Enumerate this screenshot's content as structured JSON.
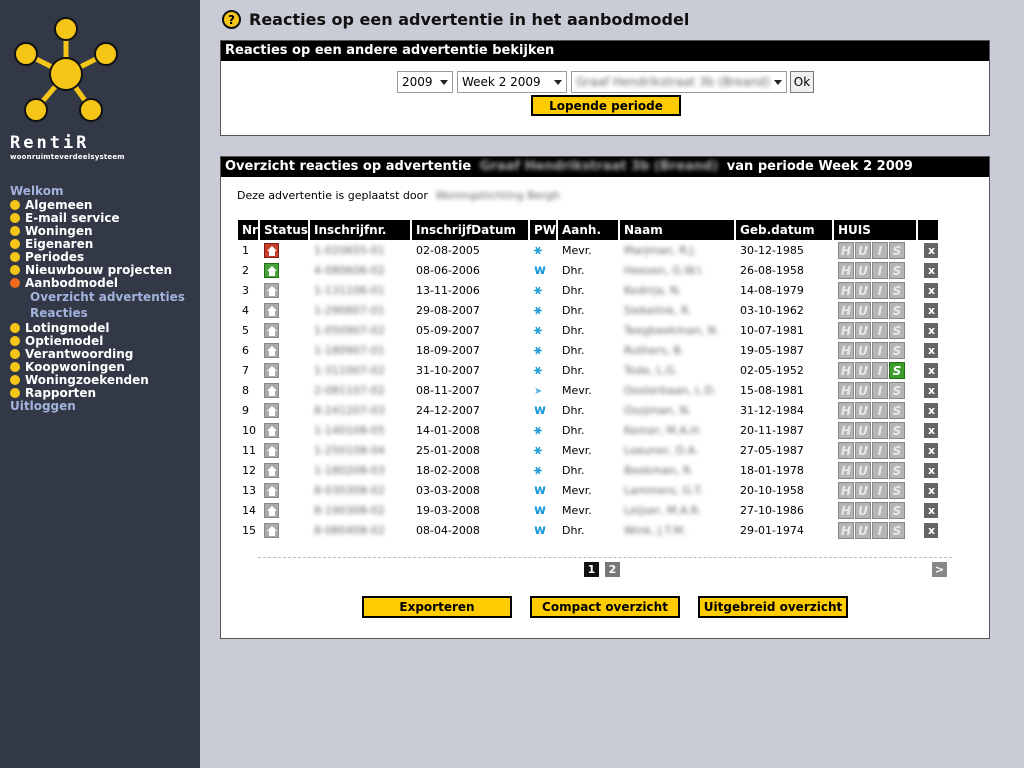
{
  "app": {
    "logo_text": "RentiR",
    "logo_subtitle": "woonruimteverdeelsysteem"
  },
  "sidebar": {
    "welcome": "Welkom",
    "items": [
      {
        "label": "Algemeen"
      },
      {
        "label": "E-mail service"
      },
      {
        "label": "Woningen"
      },
      {
        "label": "Eigenaren"
      },
      {
        "label": "Periodes"
      },
      {
        "label": "Nieuwbouw projecten"
      },
      {
        "label": "Aanbodmodel",
        "active": true
      }
    ],
    "subitems": [
      {
        "label": "Overzicht advertenties"
      },
      {
        "label": "Reacties"
      }
    ],
    "items2": [
      {
        "label": "Lotingmodel"
      },
      {
        "label": "Optiemodel"
      },
      {
        "label": "Verantwoording"
      },
      {
        "label": "Koopwoningen"
      },
      {
        "label": "Woningzoekenden"
      },
      {
        "label": "Rapporten"
      }
    ],
    "logout": "Uitloggen"
  },
  "header": {
    "help_icon": "?",
    "title": "Reacties op een advertentie in het aanbodmodel"
  },
  "selector_panel": {
    "title": "Reacties op een andere advertentie bekijken",
    "year_value": "2009",
    "week_value": "Week 2 2009",
    "address_value": "Graaf Hendrikstraat 3b (Breand)",
    "ok_label": "Ok",
    "current_period_label": "Lopende periode"
  },
  "overview_panel": {
    "title_prefix": "Overzicht reacties op advertentie",
    "title_address": "Graaf Hendrikstraat 3b (Breand)",
    "title_suffix": "van periode Week 2 2009",
    "placed_by_label": "Deze advertentie is geplaatst door",
    "placed_by_value": "Woningstichting Bergh",
    "columns": [
      "Nr",
      "Status",
      "Inschrijfnr.",
      "InschrijfDatum",
      "PW",
      "Aanh.",
      "Naam",
      "Geb.datum",
      "HUIS",
      ""
    ],
    "rows": [
      {
        "nr": "1",
        "status": "red",
        "inschrijfnr": "1-020655-01",
        "datum": "02-08-2005",
        "pw": "tree",
        "aanh": "Mevr.",
        "naam": "Marjman, R.J.",
        "geb": "30-12-1985",
        "huis_s": false
      },
      {
        "nr": "2",
        "status": "green",
        "inschrijfnr": "4-080606-02",
        "datum": "08-06-2006",
        "pw": "w",
        "aanh": "Dhr.",
        "naam": "Heesen, G.W.I.",
        "geb": "26-08-1958",
        "huis_s": false
      },
      {
        "nr": "3",
        "status": "grey",
        "inschrijfnr": "1-131106-01",
        "datum": "13-11-2006",
        "pw": "tree",
        "aanh": "Dhr.",
        "naam": "Kedrrja, N.",
        "geb": "14-08-1979",
        "huis_s": false
      },
      {
        "nr": "4",
        "status": "grey",
        "inschrijfnr": "1-290807-01",
        "datum": "29-08-2007",
        "pw": "tree",
        "aanh": "Dhr.",
        "naam": "Siebelink, R.",
        "geb": "03-10-1962",
        "huis_s": false
      },
      {
        "nr": "5",
        "status": "grey",
        "inschrijfnr": "1-050907-02",
        "datum": "05-09-2007",
        "pw": "tree",
        "aanh": "Dhr.",
        "naam": "Teegbeekman, N.",
        "geb": "10-07-1981",
        "huis_s": false
      },
      {
        "nr": "6",
        "status": "grey",
        "inschrijfnr": "1-180907-01",
        "datum": "18-09-2007",
        "pw": "tree",
        "aanh": "Dhr.",
        "naam": "Ruthers, B.",
        "geb": "19-05-1987",
        "huis_s": false
      },
      {
        "nr": "7",
        "status": "grey",
        "inschrijfnr": "1-311007-02",
        "datum": "31-10-2007",
        "pw": "tree",
        "aanh": "Dhr.",
        "naam": "Tode, L.G.",
        "geb": "02-05-1952",
        "huis_s": true
      },
      {
        "nr": "8",
        "status": "grey",
        "inschrijfnr": "2-081107-02",
        "datum": "08-11-2007",
        "pw": "arrow",
        "aanh": "Mevr.",
        "naam": "Oosterbaan, L.D.",
        "geb": "15-08-1981",
        "huis_s": false
      },
      {
        "nr": "9",
        "status": "grey",
        "inschrijfnr": "8-241207-03",
        "datum": "24-12-2007",
        "pw": "w",
        "aanh": "Dhr.",
        "naam": "Oozjman, N.",
        "geb": "31-12-1984",
        "huis_s": false
      },
      {
        "nr": "10",
        "status": "grey",
        "inschrijfnr": "1-140108-05",
        "datum": "14-01-2008",
        "pw": "tree",
        "aanh": "Dhr.",
        "naam": "Kemer, M.A.H.",
        "geb": "20-11-1987",
        "huis_s": false
      },
      {
        "nr": "11",
        "status": "grey",
        "inschrijfnr": "1-250108-04",
        "datum": "25-01-2008",
        "pw": "tree",
        "aanh": "Mevr.",
        "naam": "Loeuner, D.A.",
        "geb": "27-05-1987",
        "huis_s": false
      },
      {
        "nr": "12",
        "status": "grey",
        "inschrijfnr": "1-180208-03",
        "datum": "18-02-2008",
        "pw": "tree",
        "aanh": "Dhr.",
        "naam": "Beekman, R.",
        "geb": "18-01-1978",
        "huis_s": false
      },
      {
        "nr": "13",
        "status": "grey",
        "inschrijfnr": "8-030308-02",
        "datum": "03-03-2008",
        "pw": "w",
        "aanh": "Mevr.",
        "naam": "Lammers, G.T.",
        "geb": "20-10-1958",
        "huis_s": false
      },
      {
        "nr": "14",
        "status": "grey",
        "inschrijfnr": "8-190308-02",
        "datum": "19-03-2008",
        "pw": "w",
        "aanh": "Mevr.",
        "naam": "Leijser, M.A.R.",
        "geb": "27-10-1986",
        "huis_s": false
      },
      {
        "nr": "15",
        "status": "grey",
        "inschrijfnr": "8-080408-02",
        "datum": "08-04-2008",
        "pw": "w",
        "aanh": "Dhr.",
        "naam": "Wink, J.T.M.",
        "geb": "29-01-1974",
        "huis_s": false
      }
    ],
    "huis_letters": [
      "H",
      "U",
      "I",
      "S"
    ],
    "remove_label": "x",
    "pages": [
      "1",
      "2"
    ],
    "current_page": "1",
    "next_label": ">",
    "buttons": {
      "export": "Exporteren",
      "compact": "Compact overzicht",
      "extended": "Uitgebreid overzicht"
    }
  },
  "colors": {
    "background": "#c9ccd6",
    "sidebar": "#333846",
    "accent_yellow": "#ffcc00",
    "active_orange": "#ee6a1c",
    "nav_link": "#a3b2dd",
    "pw_blue": "#1a9ad6"
  }
}
